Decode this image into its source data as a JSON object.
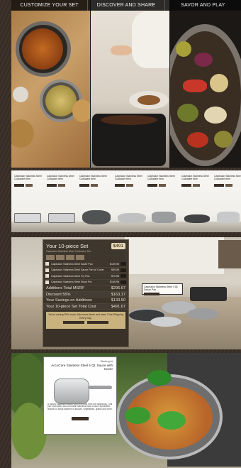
{
  "hero": {
    "tabs": [
      "CUSTOMIZE YOUR SET",
      "DISCOVER AND SHARE",
      "SAVOR AND PLAY"
    ]
  },
  "strip": {
    "item_title": "Calphalon Stainless Steel Cookware Item",
    "item_count": 7
  },
  "config": {
    "title": "Your 10-piece Set",
    "price": "$491",
    "sub": "Calphalon Stainless Steel Cookware Set",
    "items": [
      {
        "name": "Calphalon Stainless Steel Sauté Pan",
        "price": "$139.95"
      },
      {
        "name": "Calphalon Stainless Steel Sauce Pan w/ Cover",
        "price": "$99.95"
      },
      {
        "name": "Calphalon Stainless Steel Fry Pan",
        "price": "$79.95"
      },
      {
        "name": "Calphalon Stainless Steel Stock Pot",
        "price": "$149.95"
      }
    ],
    "summary": [
      {
        "label": "Additions Total MSRP",
        "value": "$296.67"
      },
      {
        "label": "Discount 55%",
        "value": "$163.17"
      },
      {
        "label": "Your Savings on Additions",
        "value": "$133.50"
      },
      {
        "label": "Your 10-piece Set Total Cost",
        "value": "$491.67"
      }
    ],
    "promo_text": "You're saving 35% more. Add more items and save. Free Shipping Every Day.",
    "tooltip": "Calphalon Stainless Steel 4 Qt. Sauce Pan"
  },
  "bottom": {
    "card_small": "Starting At",
    "card_title": "AccuCore Stainless Steel 4 Qt. Sauce with Cover",
    "card_desc": "A robust Calphalon sauce pan is a must from the beginning. This pan's tall sides and a durable stainless base ensure consistent results for small batches of sauces, vegetables, grains and more."
  },
  "colors": {
    "frame_bg": "#3a2f28",
    "panel_dark": "#322a22",
    "accent_gold": "#c9b27e"
  }
}
